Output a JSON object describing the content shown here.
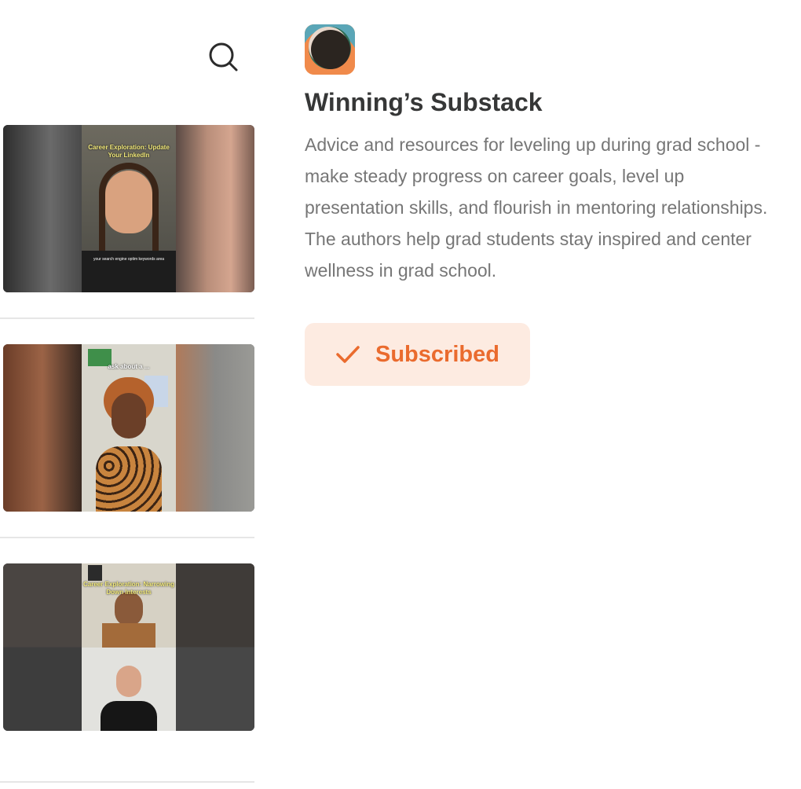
{
  "toolbar": {
    "search_icon": "search-icon"
  },
  "videos": [
    {
      "caption": "Career Exploration: Update Your LinkedIn",
      "subcaption": "your search engine optim keywords area"
    },
    {
      "caption": "ask about a ...",
      "subcaption": ""
    },
    {
      "caption": "Career Exploration: Narrowing Down Interests",
      "subcaption": ""
    }
  ],
  "publication": {
    "title": "Winning’s Substack",
    "description": "Advice and resources for leveling up during grad school - make steady progress on career goals, level up presentation skills, and flourish in mentoring relationships. The authors help grad students stay inspired and center wellness in grad school.",
    "subscribe_label": "Subscribed",
    "subscribe_icon": "checkmark-icon"
  },
  "colors": {
    "accent": "#ea6b2e",
    "accent_bg": "#fdebe1",
    "text": "#363737",
    "muted": "#767676"
  }
}
